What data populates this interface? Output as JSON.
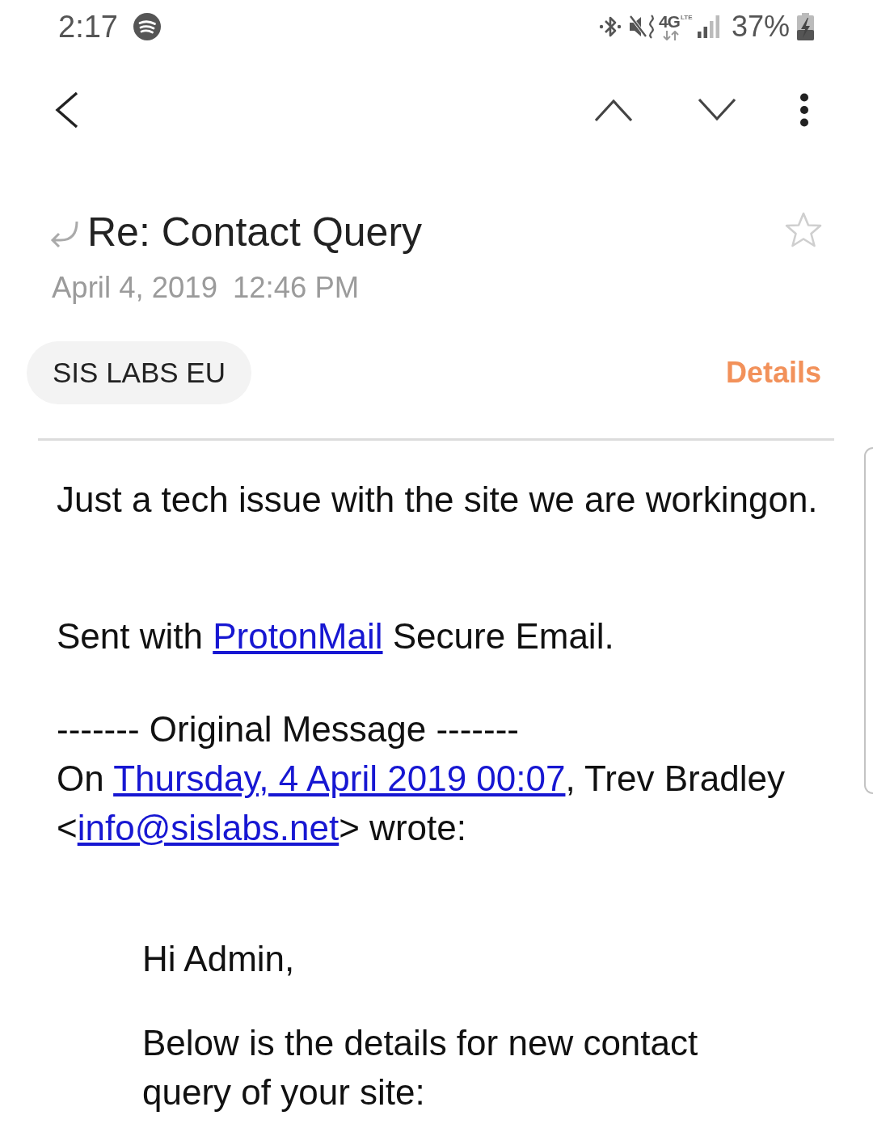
{
  "status_bar": {
    "time": "2:17",
    "network_type": "4G",
    "network_sub": "LTE",
    "battery": "37%"
  },
  "message": {
    "replied": true,
    "subject": "Re: Contact Query",
    "starred": false,
    "date": "April 4, 2019",
    "time": "12:46 PM",
    "sender": "SIS LABS EU",
    "details_link": "Details"
  },
  "body": {
    "paragraphs": [
      [
        {
          "kind": "text",
          "text": "Just a tech issue with the site we are workingon."
        }
      ],
      [
        {
          "kind": "text",
          "text": "Sent with "
        },
        {
          "kind": "link",
          "text": "ProtonMail"
        },
        {
          "kind": "text",
          "text": " Secure Email."
        }
      ]
    ],
    "original_message": {
      "separator": "------- Original Message -------",
      "attribution": [
        {
          "kind": "text",
          "text": "On "
        },
        {
          "kind": "link",
          "text": "Thursday, 4 April 2019 00:07"
        },
        {
          "kind": "text",
          "text": ", Trev Bradley <"
        },
        {
          "kind": "link",
          "text": "info@sislabs.net"
        },
        {
          "kind": "text",
          "text": "> wrote:"
        }
      ]
    },
    "quote": [
      "Hi Admin,",
      "Below is the details for new contact query of your site:"
    ]
  }
}
